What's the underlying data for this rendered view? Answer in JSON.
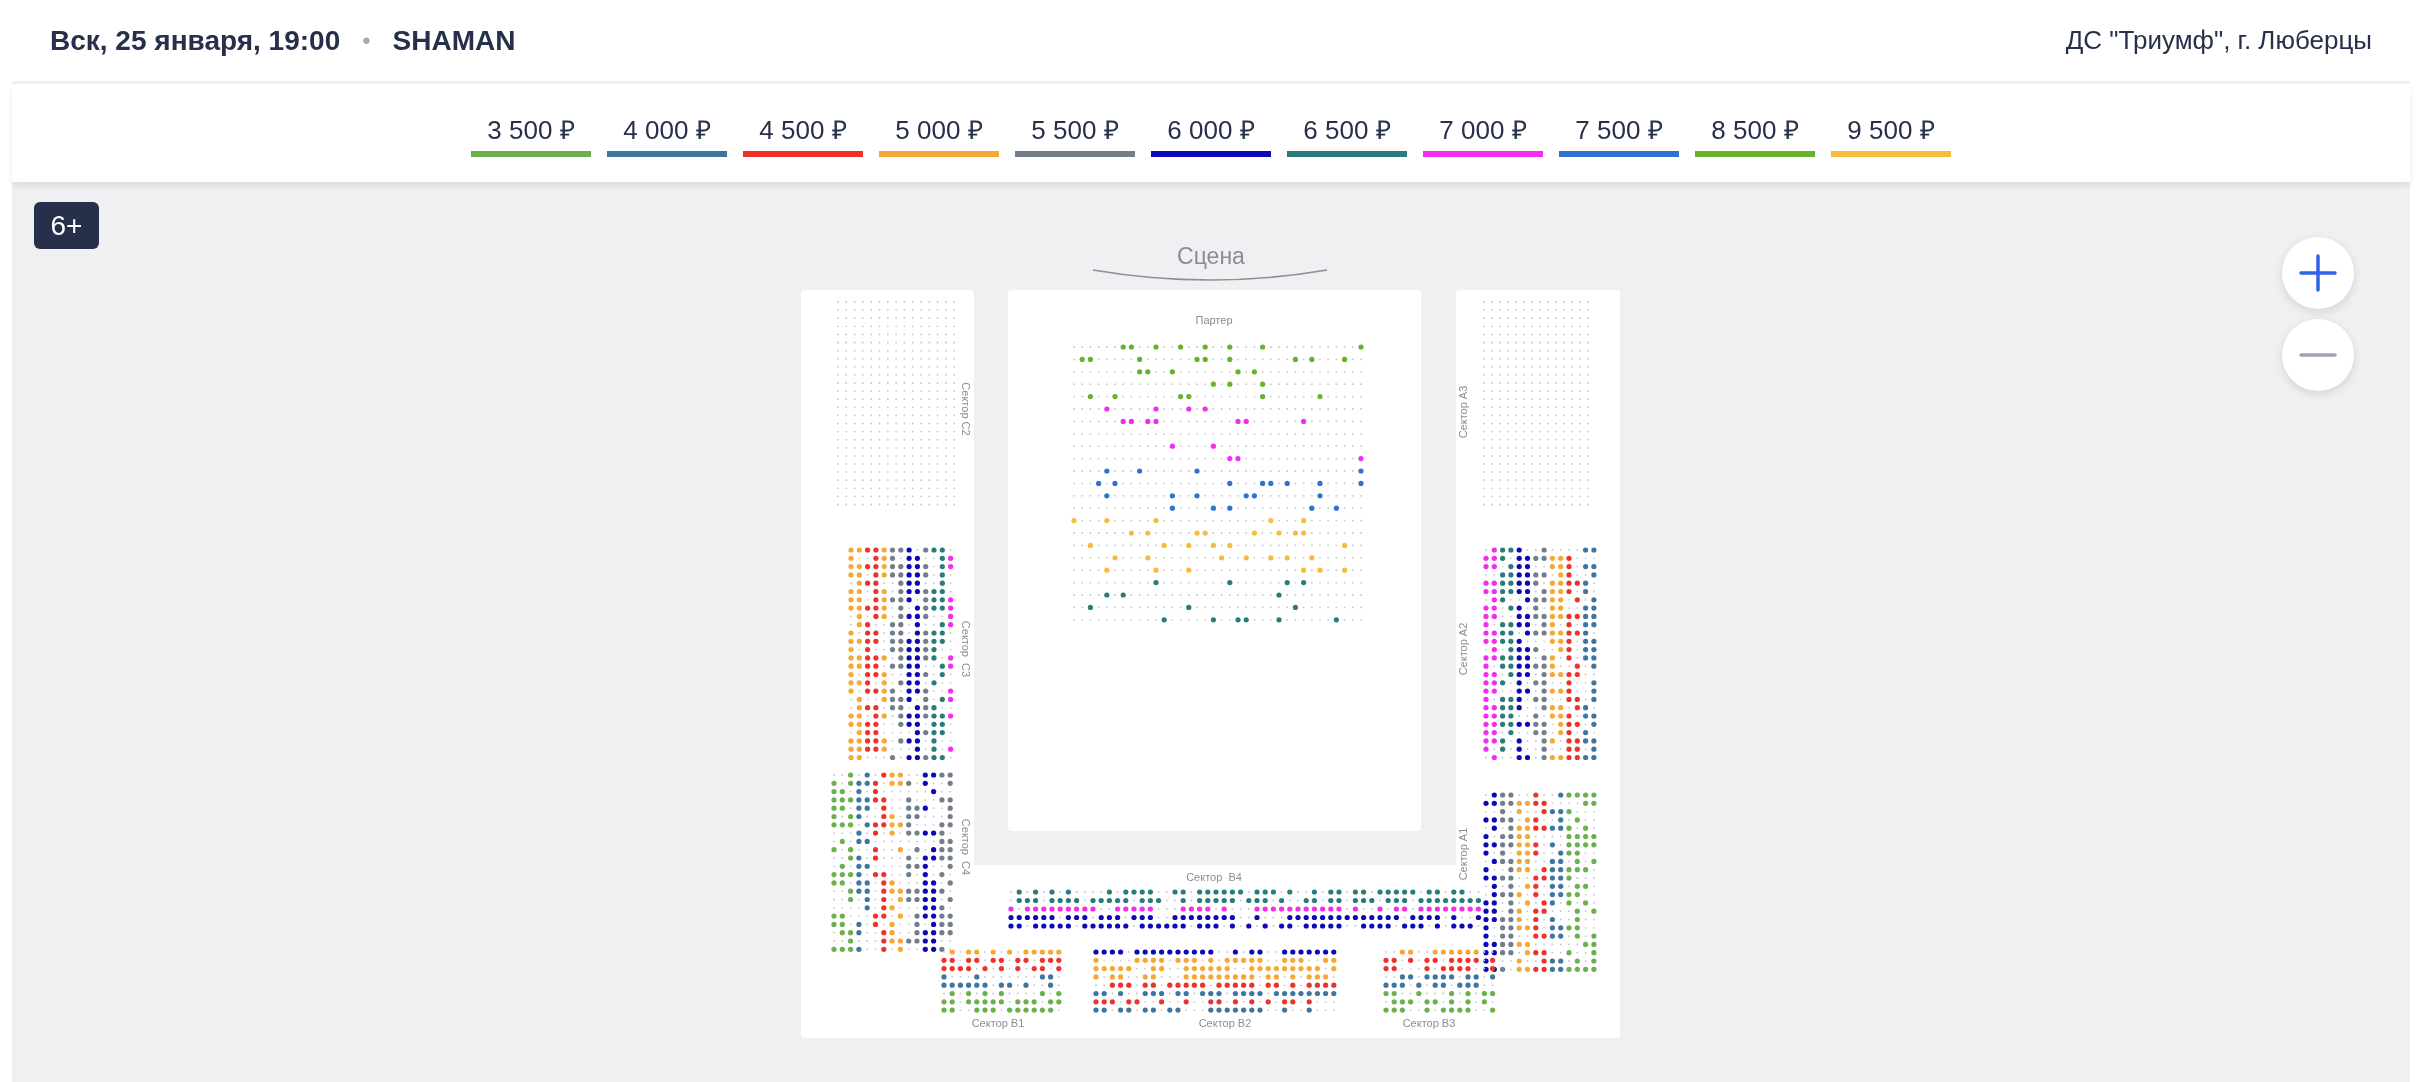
{
  "header": {
    "date": "Вск, 25 января, 19:00",
    "separator": "•",
    "artist": "SHAMAN",
    "venue": "ДС \"Триумф\", г. Люберцы"
  },
  "prices": [
    {
      "label": "3 500 ₽",
      "color": "#6ab04c"
    },
    {
      "label": "4 000 ₽",
      "color": "#3f76a0"
    },
    {
      "label": "4 500 ₽",
      "color": "#f0312a"
    },
    {
      "label": "5 000 ₽",
      "color": "#f5a833"
    },
    {
      "label": "5 500 ₽",
      "color": "#737e8c"
    },
    {
      "label": "6 000 ₽",
      "color": "#0a08b8"
    },
    {
      "label": "6 500 ₽",
      "color": "#2a7b7b"
    },
    {
      "label": "7 000 ₽",
      "color": "#f22cf0"
    },
    {
      "label": "7 500 ₽",
      "color": "#2f72d1"
    },
    {
      "label": "8 500 ₽",
      "color": "#66b22a"
    },
    {
      "label": "9 500 ₽",
      "color": "#f5bc3d"
    }
  ],
  "age_rating": "6+",
  "map": {
    "stage": "Сцена",
    "sectors": [
      {
        "label": "Партер"
      },
      {
        "label": "Сектор C2"
      },
      {
        "label": "Сектор  C3"
      },
      {
        "label": "Сектор  C4"
      },
      {
        "label": "Сектор A3"
      },
      {
        "label": "Сектор A2"
      },
      {
        "label": "Сектор A1"
      },
      {
        "label": "Сектор  B4"
      },
      {
        "label": "Сектор B1"
      },
      {
        "label": "Сектор B2"
      },
      {
        "label": "Сектор B3"
      }
    ]
  }
}
